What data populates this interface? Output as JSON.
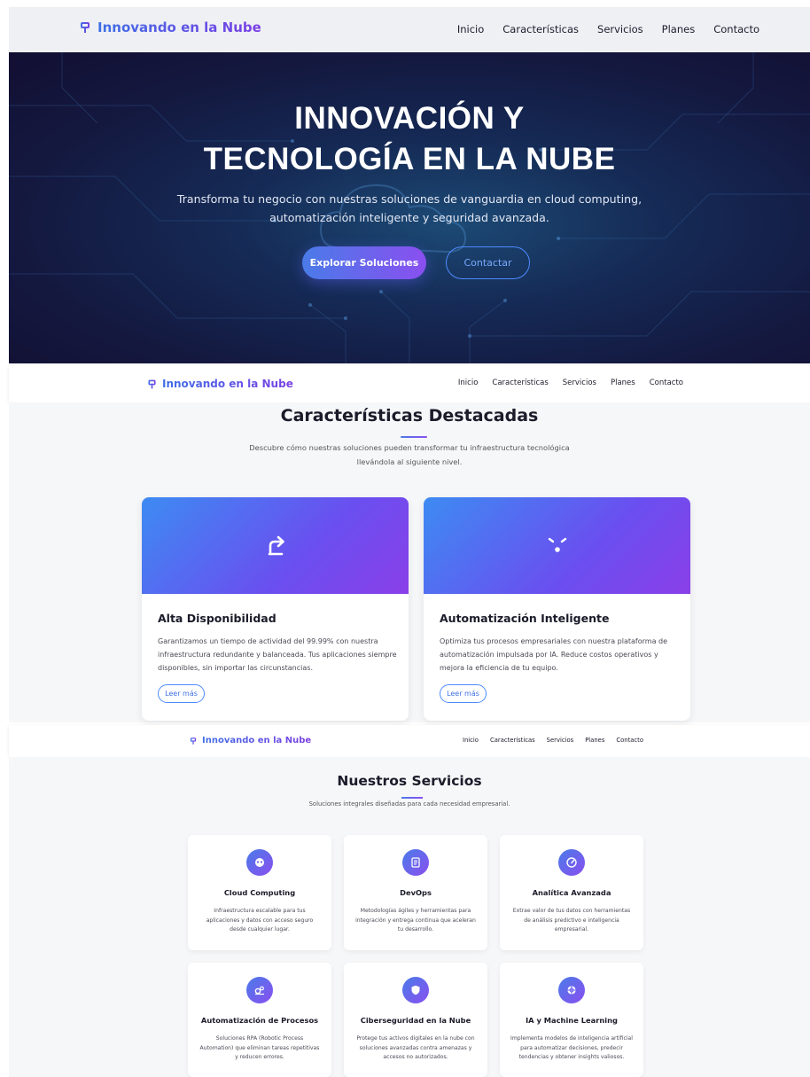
{
  "brand": {
    "name": "Innovando en la Nube"
  },
  "nav": {
    "items": [
      "Inicio",
      "Características",
      "Servicios",
      "Planes",
      "Contacto"
    ]
  },
  "hero": {
    "title_line1": "INNOVACIÓN Y",
    "title_line2": "TECNOLOGÍA EN LA NUBE",
    "subtitle": "Transforma tu negocio con nuestras soluciones de vanguardia en cloud computing, automatización inteligente y seguridad avanzada.",
    "primary_button": "Explorar Soluciones",
    "secondary_button": "Contactar"
  },
  "features": {
    "title": "Características Destacadas",
    "description": "Descubre cómo nuestras soluciones pueden transformar tu infraestructura tecnológica llevándola al siguiente nivel.",
    "cards": [
      {
        "icon": "redo-arrow-icon",
        "title": "Alta Disponibilidad",
        "text": "Garantizamos un tiempo de actividad del 99.99% con nuestra infraestructura redundante y balanceada. Tus aplicaciones siempre disponibles, sin importar las circunstancias.",
        "button": "Leer más"
      },
      {
        "icon": "robot-icon",
        "title": "Automatización Inteligente",
        "text": "Optimiza tus procesos empresariales con nuestra plataforma de automatización impulsada por IA. Reduce costos operativos y mejora la eficiencia de tu equipo.",
        "button": "Leer más"
      }
    ]
  },
  "services": {
    "title": "Nuestros Servicios",
    "description": "Soluciones integrales diseñadas para cada necesidad empresarial.",
    "cards": [
      {
        "icon": "cloud-icon",
        "title": "Cloud Computing",
        "text": "Infraestructura escalable para tus aplicaciones y datos con acceso seguro desde cualquier lugar."
      },
      {
        "icon": "document-icon",
        "title": "DevOps",
        "text": "Metodologías ágiles y herramientas para integración y entrega continua que aceleran tu desarrollo."
      },
      {
        "icon": "gauge-icon",
        "title": "Analítica Avanzada",
        "text": "Extrae valor de tus datos con herramientas de análisis predictivo e inteligencia empresarial."
      },
      {
        "icon": "gears-icon",
        "title": "Automatización de Procesos",
        "text": "Soluciones RPA (Robotic Process Automation) que eliminan tareas repetitivas y reducen errores."
      },
      {
        "icon": "shield-icon",
        "title": "Ciberseguridad en la Nube",
        "text": "Protege tus activos digitales en la nube con soluciones avanzadas contra amenazas y accesos no autorizados."
      },
      {
        "icon": "network-icon",
        "title": "IA y Machine Learning",
        "text": "Implementa modelos de inteligencia artificial para automatizar decisiones, predecir tendencias y obtener insights valiosos."
      }
    ]
  },
  "colors": {
    "accent_start": "#3f6fe6",
    "accent_end": "#7b3fe4",
    "hero_bg": "#14183f",
    "outline": "#4d8bff"
  }
}
